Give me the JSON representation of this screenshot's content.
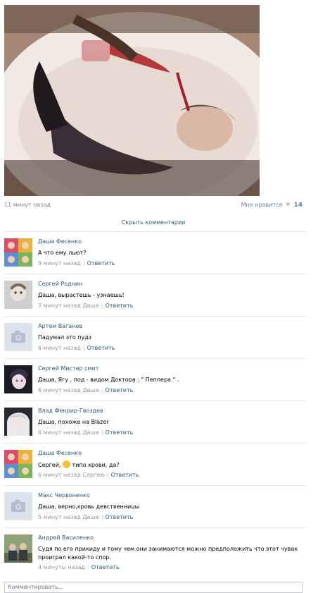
{
  "post": {
    "time_ago": "11 минут назад",
    "like_label": "Мне нравится",
    "like_count": "14"
  },
  "comments_toggle": "Скрыть комментарии",
  "comments": [
    {
      "author": "Даша Фесенко",
      "text": "А что ему льют?",
      "time": "9 минут назад",
      "reply_to": "",
      "reply_label": "Ответить"
    },
    {
      "author": "Сергей Роднин",
      "text": "Даша, вырастешь - узнаешь!",
      "time": "7 минут назад",
      "reply_to": "Даше",
      "reply_label": "Ответить"
    },
    {
      "author": "Артем Ваганов",
      "text": "Падумал это пудз",
      "time": "6 минут назад",
      "reply_to": "",
      "reply_label": "Ответить"
    },
    {
      "author": "Сергей Мистер смит",
      "text": "Даша, Ягу , под - видом Доктора : \" Пеппера \" .",
      "time": "6 минут назад",
      "reply_to": "Даше",
      "reply_label": "Ответить"
    },
    {
      "author": "Влад Фенрир-Гвоздев",
      "text": "Даша, похоже на Blazer",
      "time": "6 минут назад",
      "reply_to": "Даше",
      "reply_label": "Ответить"
    },
    {
      "author": "Даша Фесенко",
      "text_before": "Сергей,",
      "text_after": "типо крови, да?",
      "time": "6 минут назад",
      "reply_to": "Сергею",
      "reply_label": "Ответить"
    },
    {
      "author": "Макс Червоненко",
      "text": "Даша, верно,кровь девственницы",
      "time": "5 минут назад",
      "reply_to": "Даше",
      "reply_label": "Ответить"
    },
    {
      "author": "Андрей Василенко",
      "text": "Судя по его прикиду и тому чем они занимаются можно предположить что этот чувак проиграл какой-то спор.",
      "time": "4 минуты назад",
      "reply_to": "",
      "reply_label": "Ответить"
    }
  ],
  "composer": {
    "placeholder": "Комментировать..."
  },
  "colors": {
    "link": "#2b587a",
    "muted": "#8b97a3",
    "like": "#6b86a3",
    "divider": "#e7eaed"
  }
}
